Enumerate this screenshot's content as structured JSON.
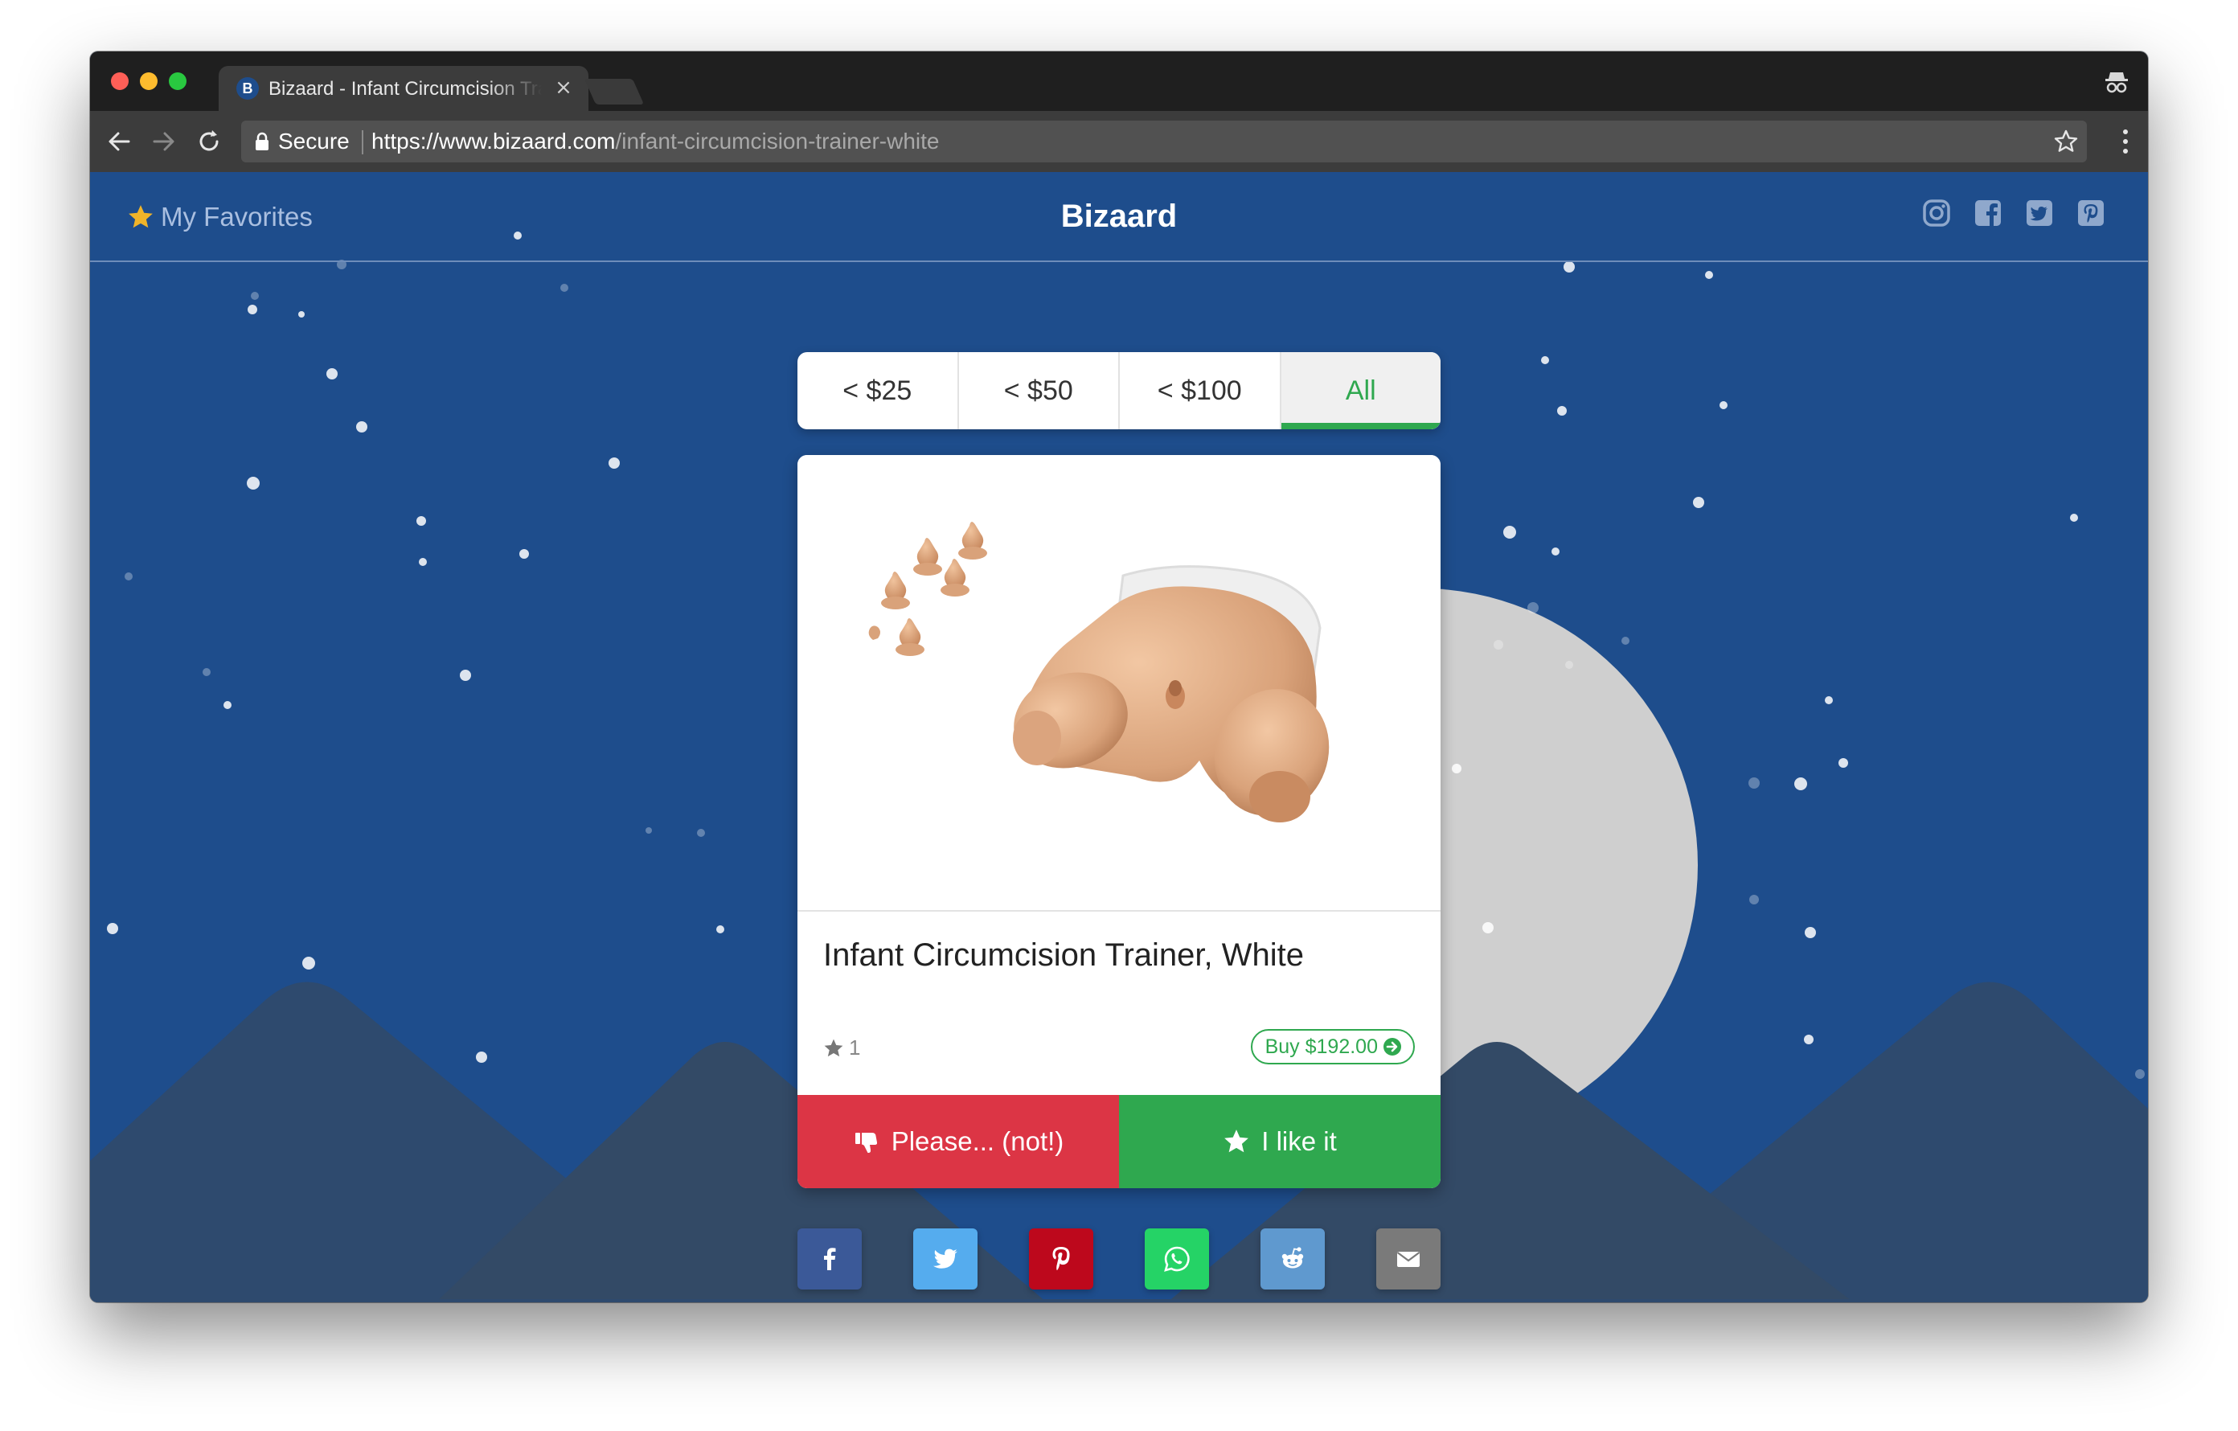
{
  "browser": {
    "tab": {
      "favicon_letter": "B",
      "title": "Bizaard - Infant Circumcision Trainer, White",
      "close_glyph": "×"
    },
    "toolbar": {
      "secure_label": "Secure",
      "url_host": "https://www.bizaard.com",
      "url_path": "/infant-circumcision-trainer-white"
    },
    "icons": [
      "back-icon",
      "forward-icon",
      "reload-icon",
      "lock-icon",
      "bookmark-star-icon",
      "menu-icon",
      "incognito-icon"
    ]
  },
  "site": {
    "favorites_label": "My Favorites",
    "title": "Bizaard",
    "social_links": [
      "instagram-icon",
      "facebook-icon",
      "twitter-icon",
      "pinterest-icon"
    ]
  },
  "filters": [
    {
      "label": "< $25",
      "active": false
    },
    {
      "label": "< $50",
      "active": false
    },
    {
      "label": "< $100",
      "active": false
    },
    {
      "label": "All",
      "active": true
    }
  ],
  "product": {
    "title": "Infant Circumcision Trainer, White",
    "likes": "1",
    "buy_label": "Buy $192.00",
    "reject_label": "Please... (not!)",
    "like_label": "I like it"
  },
  "share": [
    "facebook",
    "twitter",
    "pinterest",
    "whatsapp",
    "reddit",
    "email"
  ],
  "colors": {
    "page_background": "#1e4d8c",
    "mountain_back": "#2e4a6e",
    "mountain_front": "#33465f",
    "moon": "#cfcfcf",
    "accent_green": "#2fa84f",
    "reject_red": "#dc3545",
    "favorite_star": "#f0b429"
  }
}
